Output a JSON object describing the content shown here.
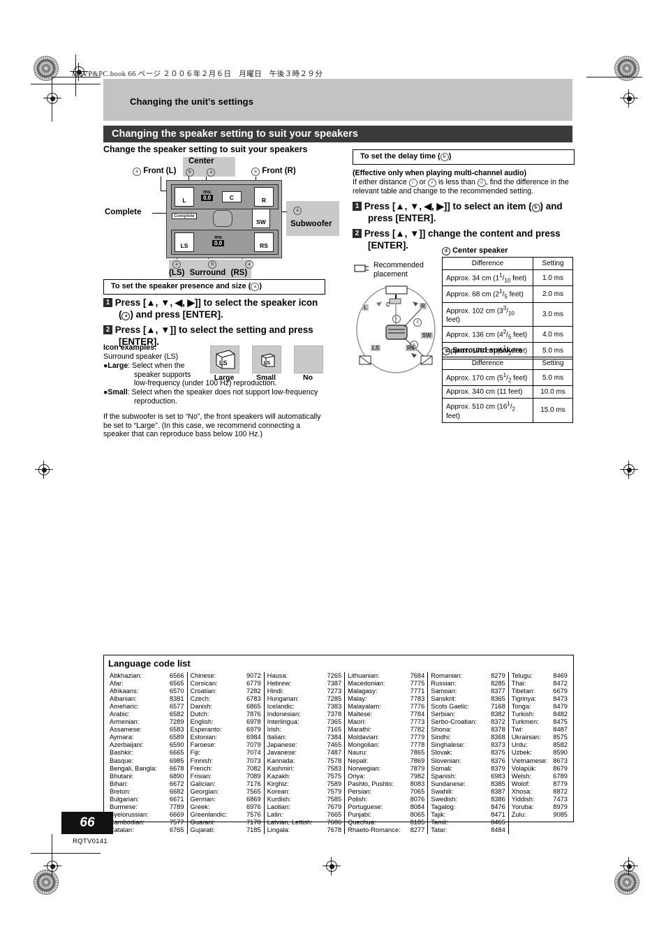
{
  "file_header": "M6VP&PC.book  66 ページ  ２００６年２月６日　月曜日　午後３時２９分",
  "section_label": "Changing the unit's settings",
  "page_title": "Changing the speaker setting to suit your speakers",
  "page_number": "66",
  "page_code": "RQTV0141",
  "left": {
    "heading": "Change the speaker setting to suit your speakers",
    "diagram": {
      "front_l": "Front (L)",
      "front_r": "Front (R)",
      "center": "Center",
      "subwoofer": "Subwoofer",
      "complete": "Complete",
      "surround": "Surround",
      "ls_label": "(LS)",
      "rs_label": "(RS)",
      "mark_a": "a",
      "mark_b": "b",
      "spk_l": "L",
      "spk_r": "R",
      "spk_c": "C",
      "spk_sw": "SW",
      "spk_ls": "LS",
      "spk_rs": "RS",
      "ms_unit": "ms",
      "ms_center": "0.0",
      "ms_surround": "0.0"
    },
    "box_title": "To set the speaker presence and size (",
    "box_title_tail": ")",
    "step1_a": "Press [",
    "step1_b": "] to select the speaker icon",
    "step1_c": "(",
    "step1_d": ") and press [ENTER].",
    "step2_a": "Press [",
    "step2_b": "] to select the setting and press",
    "step2_c": "[ENTER].",
    "arrows_4": "▲, ▼, ◀, ▶",
    "arrows_2": "▲, ▼",
    "icon_examples_title": "Icon examples:",
    "icon_examples_sub": "Surround speaker (LS)",
    "icons": [
      {
        "caption": "Large",
        "glyph": "LS",
        "style": "large"
      },
      {
        "caption": "Small",
        "glyph": "LS",
        "style": "small"
      },
      {
        "caption": "No",
        "glyph": "",
        "style": "none"
      }
    ],
    "bullet_large_term": "Large",
    "bullet_large_text_1": ": Select when the",
    "bullet_large_text_2": "speaker supports",
    "bullet_large_text_3": "low-frequency (under 100 Hz) reproduction.",
    "bullet_small_term": "Small",
    "bullet_small_text_1": ": Select when the speaker does not support low-frequency",
    "bullet_small_text_2": "reproduction.",
    "note_1": "If the subwoofer is set to “No”, the front speakers will automatically",
    "note_2": "be set to “Large”. (In this case, we recommend connecting a",
    "note_3": "speaker that can reproduce bass below 100 Hz.)"
  },
  "right": {
    "box_title": "To set the delay time (",
    "box_title_tail": ")",
    "effective_note": "(Effective only when playing multi-channel audio)",
    "intro_1a": "If either distance ",
    "intro_1b": " or ",
    "intro_1c": " is less than ",
    "intro_1d": ", find the difference in the",
    "intro_2": "relevant table and change to the recommended setting.",
    "step1_a": "Press [",
    "step1_b": "] to select an item (",
    "step1_c": ") and",
    "step1_d": "press [ENTER].",
    "step2_a": "Press [",
    "step2_b": "] change the content and press",
    "step2_c": "[ENTER].",
    "arrows_4": "▲, ▼, ◀, ▶",
    "arrows_2": "▲, ▼",
    "placement": {
      "legend_1": "Recommended",
      "legend_2": "placement",
      "tags": [
        "L",
        "C",
        "R",
        "SW",
        "LS",
        "RS"
      ],
      "marks": [
        "c",
        "d",
        "e"
      ]
    },
    "table_center": {
      "caption": "Center speaker",
      "mark": "d",
      "columns": [
        "Difference",
        "Setting"
      ],
      "rows": [
        {
          "cm": "Approx. 34 cm (1",
          "num": "1",
          "den": "10",
          "tail": " feet)",
          "setting": "1.0 ms"
        },
        {
          "cm": "Approx. 68 cm (2",
          "num": "1",
          "den": "5",
          "tail": " feet)",
          "setting": "2.0 ms"
        },
        {
          "cm": "Approx. 102 cm (3",
          "num": "3",
          "den": "10",
          "tail": " feet)",
          "setting": "3.0 ms"
        },
        {
          "cm": "Approx. 136 cm (4",
          "num": "2",
          "den": "5",
          "tail": " feet)",
          "setting": "4.0 ms"
        },
        {
          "cm": "Approx. 170 cm (5",
          "num": "1",
          "den": "2",
          "tail": " feet)",
          "setting": "5.0 ms"
        }
      ]
    },
    "table_surround": {
      "caption": "Surround speakers",
      "mark": "f",
      "columns": [
        "Difference",
        "Setting"
      ],
      "rows": [
        {
          "cm": "Approx. 170 cm (5",
          "num": "1",
          "den": "2",
          "tail": " feet)",
          "setting": "5.0 ms"
        },
        {
          "cm": "Approx. 340 cm (11 feet)",
          "num": "",
          "den": "",
          "tail": "",
          "setting": "10.0 ms"
        },
        {
          "cm": "Approx. 510 cm (16",
          "num": "1",
          "den": "2",
          "tail": " feet)",
          "setting": "15.0 ms"
        }
      ]
    }
  },
  "language_list": {
    "title": "Language code list",
    "columns": [
      [
        [
          "Abkhazian:",
          "6566"
        ],
        [
          "Afar:",
          "6565"
        ],
        [
          "Afrikaans:",
          "6570"
        ],
        [
          "Albanian:",
          "8381"
        ],
        [
          "Ameharic:",
          "6577"
        ],
        [
          "Arabic:",
          "6582"
        ],
        [
          "Armenian:",
          "7289"
        ],
        [
          "Assamese:",
          "6583"
        ],
        [
          "Aymara:",
          "6589"
        ],
        [
          "Azerbaijani:",
          "6590"
        ],
        [
          "Bashkir:",
          "6665"
        ],
        [
          "Basque:",
          "6985"
        ],
        [
          "Bengali, Bangla:",
          "6678"
        ],
        [
          "Bhutani:",
          "6890"
        ],
        [
          "Bihari:",
          "6672"
        ],
        [
          "Breton:",
          "6682"
        ],
        [
          "Bulgarian:",
          "6671"
        ],
        [
          "Burmese:",
          "7789"
        ],
        [
          "Byelorussian:",
          "6669"
        ],
        [
          "Cambodian:",
          "7577"
        ],
        [
          "Catalan:",
          "6765"
        ]
      ],
      [
        [
          "Chinese:",
          "9072"
        ],
        [
          "Corsican:",
          "6779"
        ],
        [
          "Croatian:",
          "7282"
        ],
        [
          "Czech:",
          "6783"
        ],
        [
          "Danish:",
          "6865"
        ],
        [
          "Dutch:",
          "7876"
        ],
        [
          "English:",
          "6978"
        ],
        [
          "Esperanto:",
          "6979"
        ],
        [
          "Estonian:",
          "6984"
        ],
        [
          "Faroese:",
          "7079"
        ],
        [
          "Fiji:",
          "7074"
        ],
        [
          "Finnish:",
          "7073"
        ],
        [
          "French:",
          "7082"
        ],
        [
          "Frisian:",
          "7089"
        ],
        [
          "Galician:",
          "7176"
        ],
        [
          "Georgian:",
          "7565"
        ],
        [
          "German:",
          "6869"
        ],
        [
          "Greek:",
          "6976"
        ],
        [
          "Greenlandic:",
          "7576"
        ],
        [
          "Guarani:",
          "7178"
        ],
        [
          "Gujarati:",
          "7185"
        ]
      ],
      [
        [
          "Hausa:",
          "7265"
        ],
        [
          "Hebrew:",
          "7387"
        ],
        [
          "Hindi:",
          "7273"
        ],
        [
          "Hungarian:",
          "7285"
        ],
        [
          "Icelandic:",
          "7383"
        ],
        [
          "Indonesian:",
          "7378"
        ],
        [
          "Interlingua:",
          "7365"
        ],
        [
          "Irish:",
          "7165"
        ],
        [
          "Italian:",
          "7384"
        ],
        [
          "Japanese:",
          "7465"
        ],
        [
          "Javanese:",
          "7487"
        ],
        [
          "Kannada:",
          "7578"
        ],
        [
          "Kashmiri:",
          "7583"
        ],
        [
          "Kazakh:",
          "7575"
        ],
        [
          "Kirghiz:",
          "7589"
        ],
        [
          "Korean:",
          "7579"
        ],
        [
          "Kurdish:",
          "7585"
        ],
        [
          "Laotian:",
          "7679"
        ],
        [
          "Latin:",
          "7665"
        ],
        [
          "Latvian, Lettish:",
          "7686"
        ],
        [
          "Lingala:",
          "7678"
        ]
      ],
      [
        [
          "Lithuanian:",
          "7684"
        ],
        [
          "Macedonian:",
          "7775"
        ],
        [
          "Malagasy:",
          "7771"
        ],
        [
          "Malay:",
          "7783"
        ],
        [
          "Malayalam:",
          "7776"
        ],
        [
          "Maltese:",
          "7784"
        ],
        [
          "Maori:",
          "7773"
        ],
        [
          "Marathi:",
          "7782"
        ],
        [
          "Moldavian:",
          "7779"
        ],
        [
          "Mongolian:",
          "7778"
        ],
        [
          "Nauru:",
          "7865"
        ],
        [
          "Nepali:",
          "7869"
        ],
        [
          "Norwegian:",
          "7879"
        ],
        [
          "Oriya:",
          "7982"
        ],
        [
          "Pashto, Pushto:",
          "8083"
        ],
        [
          "Persian:",
          "7065"
        ],
        [
          "Polish:",
          "8076"
        ],
        [
          "Portuguese:",
          "8084"
        ],
        [
          "Punjabi:",
          "8065"
        ],
        [
          "Quechua:",
          "8185"
        ],
        [
          "Rhaeto-Romance:",
          "8277"
        ]
      ],
      [
        [
          "Romanian:",
          "8279"
        ],
        [
          "Russian:",
          "8285"
        ],
        [
          "Samoan:",
          "8377"
        ],
        [
          "Sanskrit:",
          "8365"
        ],
        [
          "Scots Gaelic:",
          "7168"
        ],
        [
          "Serbian:",
          "8382"
        ],
        [
          "Serbo-Croatian:",
          "8372"
        ],
        [
          "Shona:",
          "8378"
        ],
        [
          "Sindhi:",
          "8368"
        ],
        [
          "Singhalese:",
          "8373"
        ],
        [
          "Slovak:",
          "8375"
        ],
        [
          "Slovenian:",
          "8376"
        ],
        [
          "Somali:",
          "8379"
        ],
        [
          "Spanish:",
          "6983"
        ],
        [
          "Sundanese:",
          "8385"
        ],
        [
          "Swahili:",
          "8387"
        ],
        [
          "Swedish:",
          "8386"
        ],
        [
          "Tagalog:",
          "8476"
        ],
        [
          "Tajik:",
          "8471"
        ],
        [
          "Tamil:",
          "8465"
        ],
        [
          "Tatar:",
          "8484"
        ]
      ],
      [
        [
          "Telugu:",
          "8469"
        ],
        [
          "Thai:",
          "8472"
        ],
        [
          "Tibetan:",
          "6679"
        ],
        [
          "Tigrinya:",
          "8473"
        ],
        [
          "Tonga:",
          "8479"
        ],
        [
          "Turkish:",
          "8482"
        ],
        [
          "Turkmen:",
          "8475"
        ],
        [
          "Twi:",
          "8487"
        ],
        [
          "Ukrainian:",
          "8575"
        ],
        [
          "Urdu:",
          "8582"
        ],
        [
          "Uzbek:",
          "8590"
        ],
        [
          "Vietnamese:",
          "8673"
        ],
        [
          "Volapük:",
          "8679"
        ],
        [
          "Welsh:",
          "6789"
        ],
        [
          "Wolof:",
          "8779"
        ],
        [
          "Xhosa:",
          "8872"
        ],
        [
          "Yiddish:",
          "7473"
        ],
        [
          "Yoruba:",
          "8979"
        ],
        [
          "Zulu:",
          "9085"
        ]
      ]
    ]
  }
}
